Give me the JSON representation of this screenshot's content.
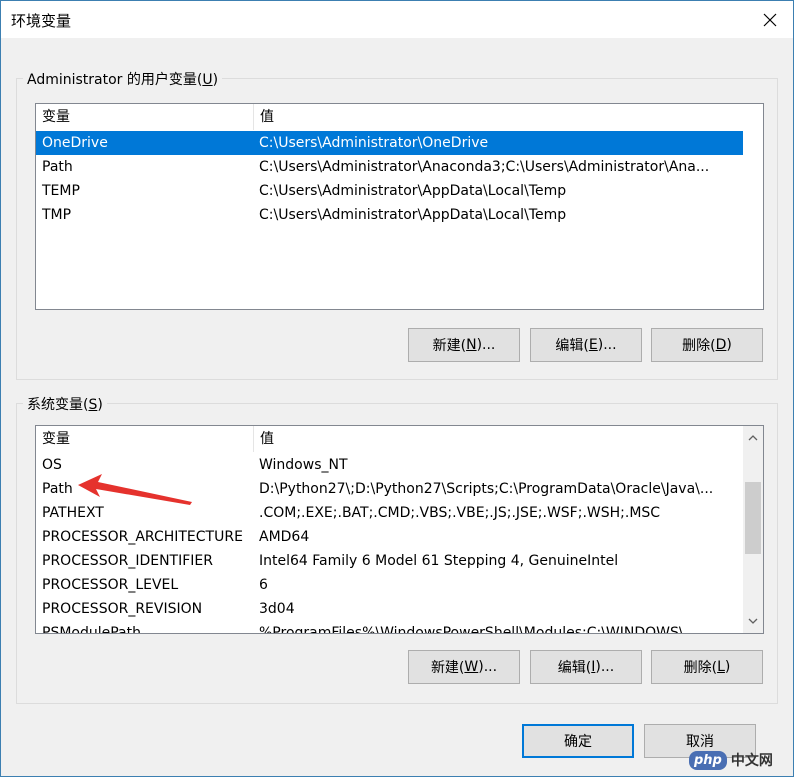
{
  "window": {
    "title": "环境变量",
    "close_icon": "close-icon"
  },
  "user_group": {
    "legend_prefix": "Administrator 的用户变量(",
    "legend_key": "U",
    "legend_suffix": ")",
    "columns": [
      "变量",
      "值"
    ],
    "rows": [
      {
        "name": "OneDrive",
        "value": "C:\\Users\\Administrator\\OneDrive",
        "selected": true
      },
      {
        "name": "Path",
        "value": "C:\\Users\\Administrator\\Anaconda3;C:\\Users\\Administrator\\Ana..."
      },
      {
        "name": "TEMP",
        "value": "C:\\Users\\Administrator\\AppData\\Local\\Temp"
      },
      {
        "name": "TMP",
        "value": "C:\\Users\\Administrator\\AppData\\Local\\Temp"
      }
    ],
    "buttons": {
      "new": {
        "prefix": "新建(",
        "key": "N",
        "suffix": ")..."
      },
      "edit": {
        "prefix": "编辑(",
        "key": "E",
        "suffix": ")..."
      },
      "delete": {
        "prefix": "删除(",
        "key": "D",
        "suffix": ")"
      }
    }
  },
  "system_group": {
    "legend_prefix": "系统变量(",
    "legend_key": "S",
    "legend_suffix": ")",
    "columns": [
      "变量",
      "值"
    ],
    "rows": [
      {
        "name": "OS",
        "value": "Windows_NT"
      },
      {
        "name": "Path",
        "value": "D:\\Python27\\;D:\\Python27\\Scripts;C:\\ProgramData\\Oracle\\Java\\..."
      },
      {
        "name": "PATHEXT",
        "value": ".COM;.EXE;.BAT;.CMD;.VBS;.VBE;.JS;.JSE;.WSF;.WSH;.MSC"
      },
      {
        "name": "PROCESSOR_ARCHITECTURE",
        "value": "AMD64"
      },
      {
        "name": "PROCESSOR_IDENTIFIER",
        "value": "Intel64 Family 6 Model 61 Stepping 4, GenuineIntel"
      },
      {
        "name": "PROCESSOR_LEVEL",
        "value": "6"
      },
      {
        "name": "PROCESSOR_REVISION",
        "value": "3d04"
      },
      {
        "name": "PSModulePath",
        "value": "%ProgramFiles%\\WindowsPowerShell\\Modules;C:\\WINDOWS\\..."
      }
    ],
    "buttons": {
      "new": {
        "prefix": "新建(",
        "key": "W",
        "suffix": ")..."
      },
      "edit": {
        "prefix": "编辑(",
        "key": "I",
        "suffix": ")..."
      },
      "delete": {
        "prefix": "删除(",
        "key": "L",
        "suffix": ")"
      }
    },
    "scroll_position": 0.25
  },
  "footer": {
    "ok_label": "确定",
    "cancel_label": "取消"
  },
  "watermark": {
    "badge": "php",
    "text": "中文网"
  },
  "colors": {
    "selection": "#0078d7",
    "annotation_arrow": "#e5322d",
    "window_border": "#3c7fb1"
  }
}
